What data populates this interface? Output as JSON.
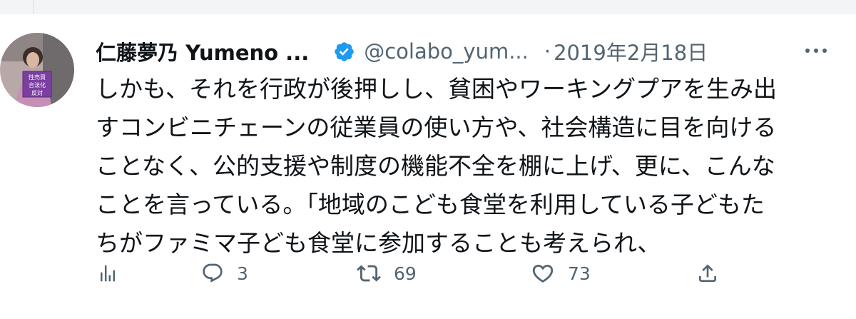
{
  "tweet": {
    "author_name": "仁藤夢乃 Yumeno ...",
    "handle": "@colabo_yum...",
    "separator": "·",
    "timestamp": "2019年2月18日",
    "avatar_sign_text": [
      "性売買",
      "合法化",
      "反対"
    ],
    "text_lines": [
      "しかも、それを行政が後押しし、貧困やワーキングプアを生み出",
      "すコンビニチェーンの従業員の使い方や、社会構造に目を向ける",
      "ことなく、公的支援や制度の機能不全を棚に上げ、更に、こんな",
      "ことを言っている。「地域のこども食堂を利用している子どもた",
      "ちがファミマ子ども食堂に参加することも考えられ、"
    ]
  },
  "actions": {
    "analytics_icon": "analytics-icon",
    "reply_icon": "reply-icon",
    "reply_count": "3",
    "retweet_icon": "retweet-icon",
    "retweet_count": "69",
    "like_icon": "heart-icon",
    "like_count": "73",
    "share_icon": "share-icon"
  },
  "colors": {
    "text_primary": "#0f1419",
    "text_secondary": "#536471",
    "verified_blue": "#1d9bf0",
    "sign_purple": "#7b3fa0",
    "divider": "#e6e9eb"
  }
}
